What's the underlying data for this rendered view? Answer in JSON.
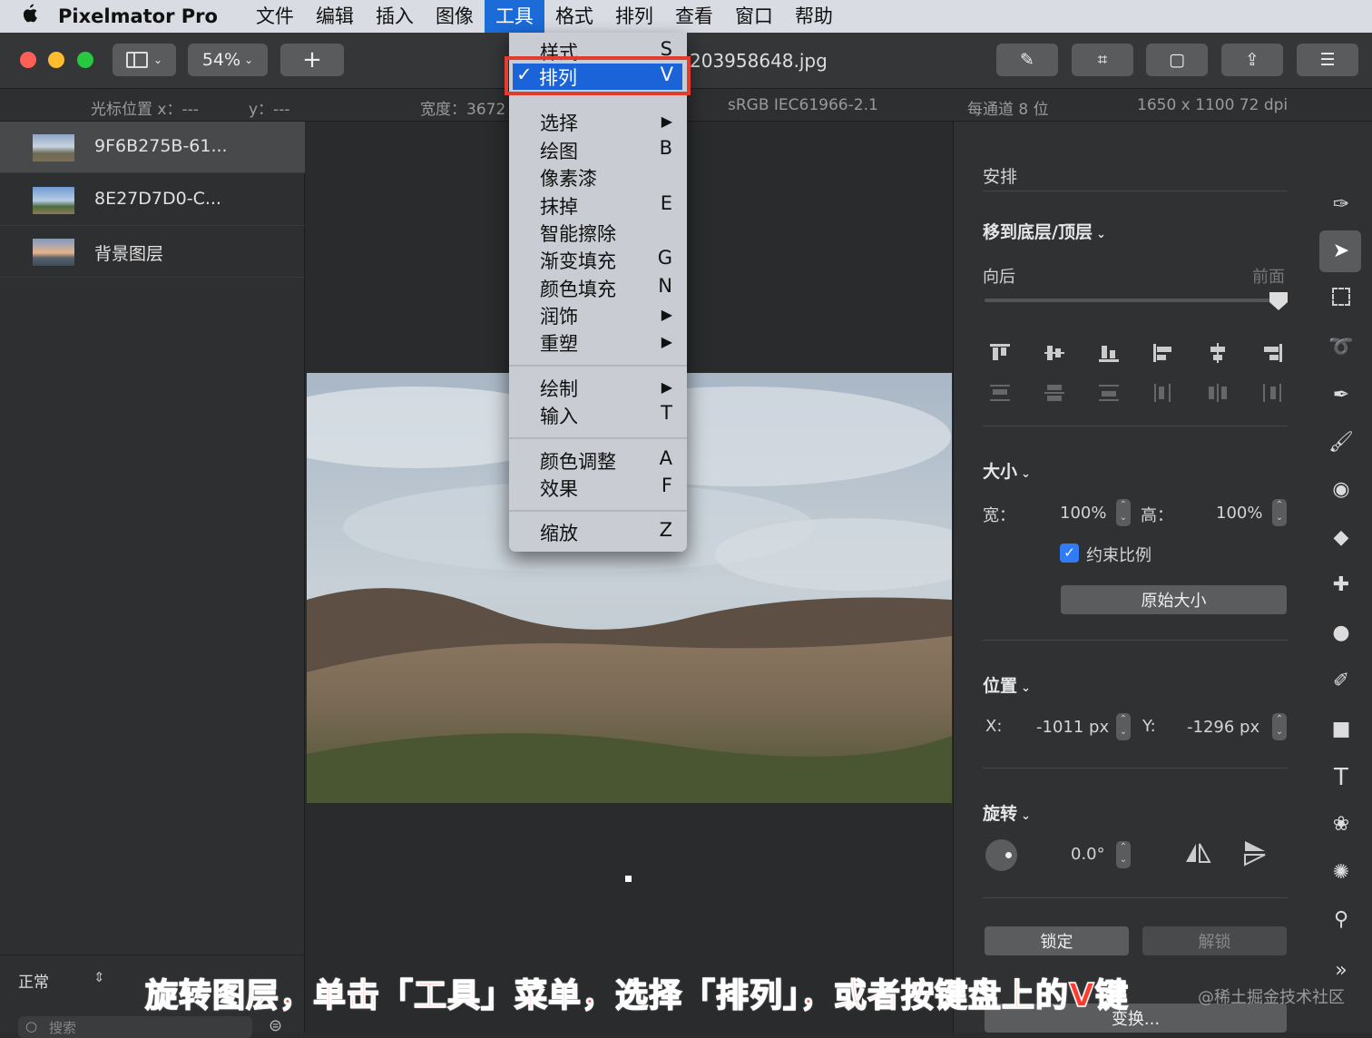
{
  "menubar": {
    "apple": "",
    "app": "Pixelmator Pro",
    "items": [
      "文件",
      "编辑",
      "插入",
      "图像",
      "工具",
      "格式",
      "排列",
      "查看",
      "窗口",
      "帮助"
    ]
  },
  "toolbar": {
    "zoom": "54%",
    "add": "+",
    "doc_title": "203958648.jpg"
  },
  "infobar": {
    "cursor_x": "光标位置 x：---",
    "cursor_y": "y：---",
    "width": "宽度：3672",
    "colorspace": "sRGB IEC61966-2.1",
    "bits": "每通道 8 位",
    "size": "1650 x 1100 72 dpi"
  },
  "layers": [
    {
      "name": "9F6B275B-61..."
    },
    {
      "name": "8E27D7D0-C..."
    },
    {
      "name": "背景图层"
    }
  ],
  "blend": {
    "mode": "正常",
    "search_placeholder": "搜索"
  },
  "tools_menu": {
    "items": [
      {
        "label": "样式",
        "shortcut": "S"
      },
      {
        "label": "排列",
        "shortcut": "V",
        "check": "✓"
      },
      {
        "label": "选择",
        "shortcut": "▶"
      },
      {
        "label": "绘图",
        "shortcut": "B"
      },
      {
        "label": "像素漆",
        "shortcut": ""
      },
      {
        "label": "抹掉",
        "shortcut": "E"
      },
      {
        "label": "智能擦除",
        "shortcut": ""
      },
      {
        "label": "渐变填充",
        "shortcut": "G"
      },
      {
        "label": "颜色填充",
        "shortcut": "N"
      },
      {
        "label": "润饰",
        "shortcut": "▶"
      },
      {
        "label": "重塑",
        "shortcut": "▶"
      },
      {
        "label": "绘制",
        "shortcut": "▶"
      },
      {
        "label": "输入",
        "shortcut": "T"
      },
      {
        "label": "颜色调整",
        "shortcut": "A"
      },
      {
        "label": "效果",
        "shortcut": "F"
      },
      {
        "label": "缩放",
        "shortcut": "Z"
      }
    ]
  },
  "panel": {
    "title": "安排",
    "order": {
      "label": "移到底层/顶层",
      "back": "向后",
      "front": "前面",
      "position": 1.0
    },
    "size": {
      "label": "大小",
      "w_label": "宽：",
      "w_value": "100%",
      "h_label": "高：",
      "h_value": "100%",
      "constrain": "约束比例",
      "original": "原始大小"
    },
    "position": {
      "label": "位置",
      "x_label": "X:",
      "x_value": "-1011 px",
      "y_label": "Y:",
      "y_value": "-1296 px"
    },
    "rotate": {
      "label": "旋转",
      "value": "0.0°"
    },
    "lock": "锁定",
    "unlock": "解锁",
    "transform": "变换..."
  },
  "caption": "旋转图层，单击「工具」菜单，选择「排列」，或者按键盘上的V键",
  "watermark": "@稀土掘金技术社区"
}
